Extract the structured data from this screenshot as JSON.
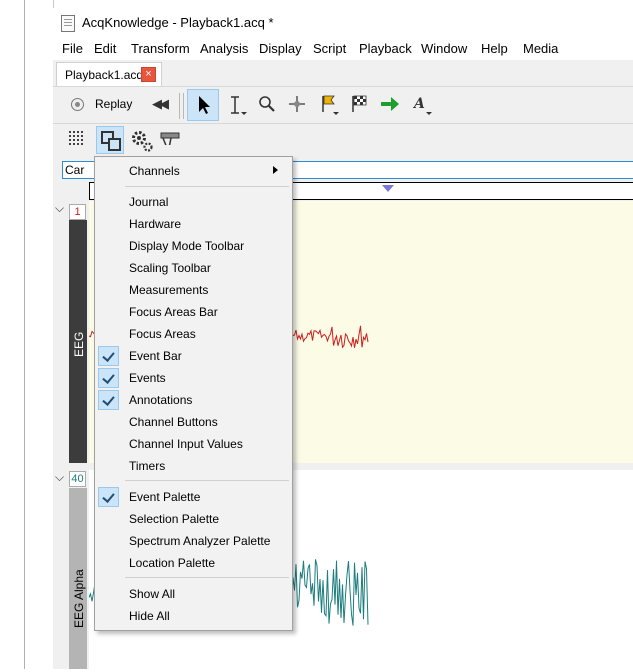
{
  "window": {
    "title": "AcqKnowledge - Playback1.acq *"
  },
  "menubar": [
    "File",
    "Edit",
    "Transform",
    "Analysis",
    "Display",
    "Script",
    "Playback",
    "Window",
    "Help",
    "Media"
  ],
  "tab": {
    "label": "Playback1.acq",
    "close_glyph": "×"
  },
  "toolbar": {
    "replay_label": "Replay",
    "rewind_glyph": "◀◀"
  },
  "search": {
    "value": "Car"
  },
  "channels": [
    {
      "number": "1",
      "label": "EEG",
      "color": "#cc1f1f",
      "number_color": "#cc1f1f",
      "bar_color": "#3c3c3c"
    },
    {
      "number": "40",
      "label": "EEG Alpha",
      "color": "#1b7d7d",
      "number_color": "#1b7d7d",
      "bar_color": "#b4b4b4"
    }
  ],
  "menu": {
    "channels": "Channels",
    "items": [
      {
        "label": "Journal",
        "checked": false
      },
      {
        "label": "Hardware",
        "checked": false
      },
      {
        "label": "Display Mode Toolbar",
        "checked": false
      },
      {
        "label": "Scaling Toolbar",
        "checked": false
      },
      {
        "label": "Measurements",
        "checked": false
      },
      {
        "label": "Focus Areas Bar",
        "checked": false
      },
      {
        "label": "Focus Areas",
        "checked": false
      },
      {
        "label": "Event Bar",
        "checked": true
      },
      {
        "label": "Events",
        "checked": true
      },
      {
        "label": "Annotations",
        "checked": true
      },
      {
        "label": "Channel Buttons",
        "checked": false
      },
      {
        "label": "Channel Input Values",
        "checked": false
      },
      {
        "label": "Timers",
        "checked": false
      }
    ],
    "palettes": [
      {
        "label": "Event Palette",
        "checked": true
      },
      {
        "label": "Selection Palette",
        "checked": false
      },
      {
        "label": "Spectrum Analyzer Palette",
        "checked": false
      },
      {
        "label": "Location Palette",
        "checked": false
      }
    ],
    "show_all": "Show All",
    "hide_all": "Hide All"
  },
  "colors": {
    "accent": "#2a8bd7",
    "check_bg": "#cce4f7",
    "plot1_bg": "#fbfbe6"
  }
}
